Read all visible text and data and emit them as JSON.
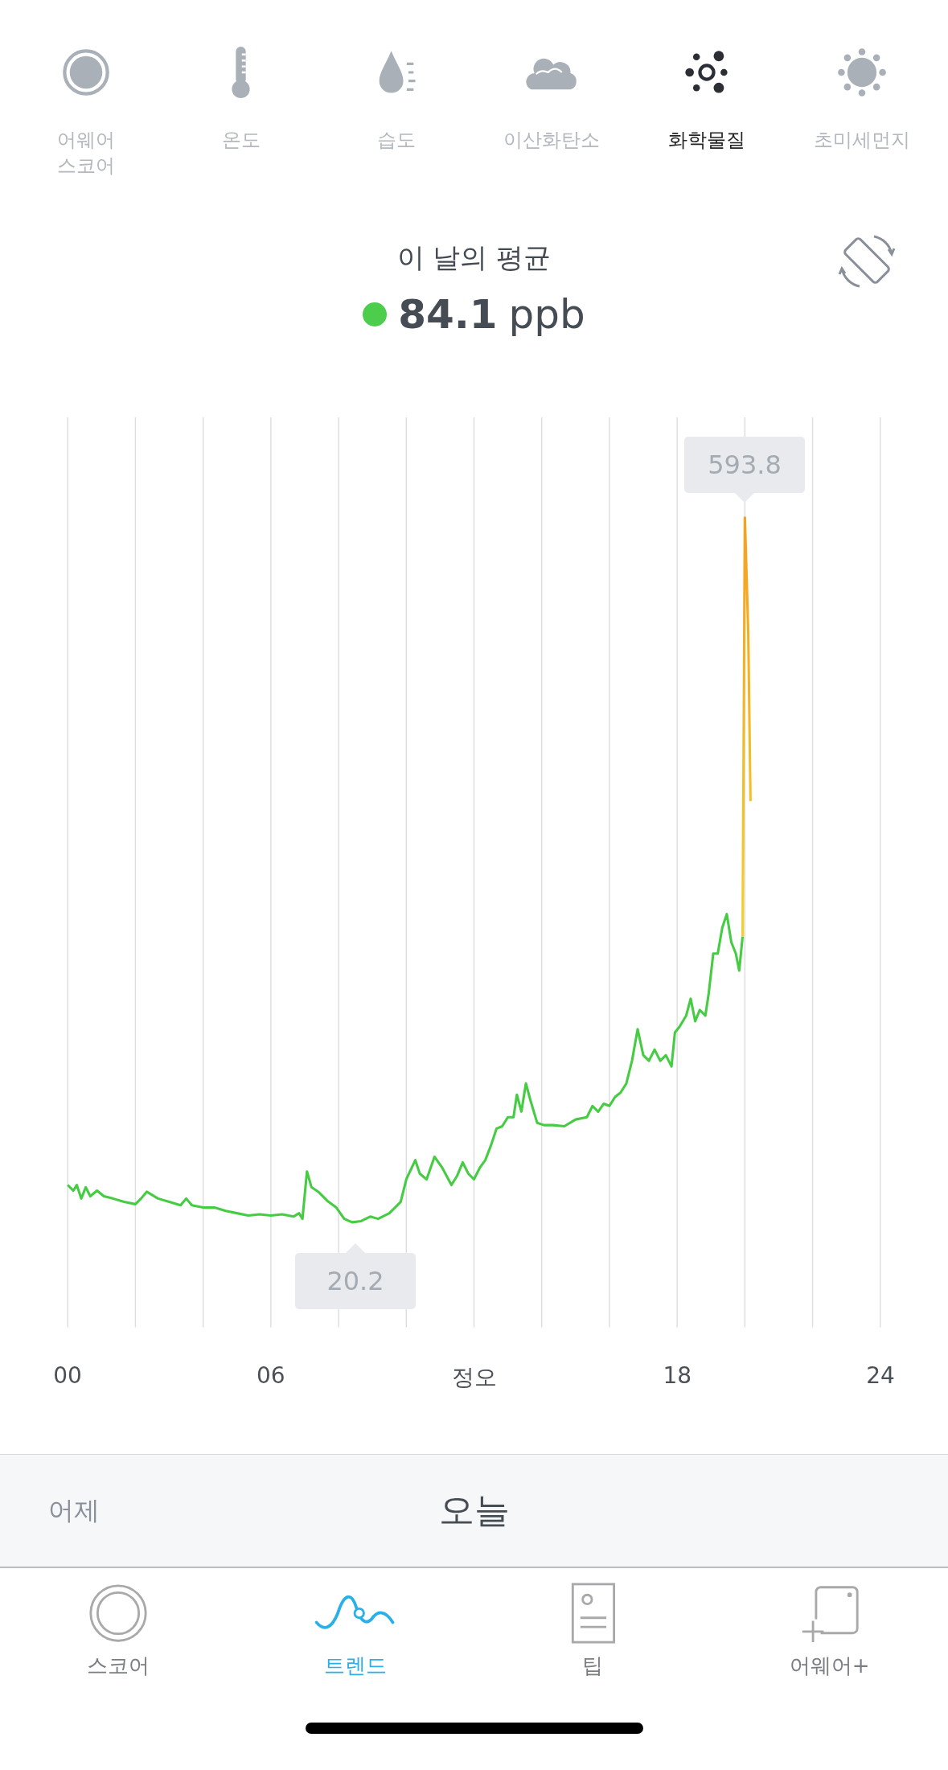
{
  "metric_tabs": [
    {
      "label": "어웨어\n스코어",
      "selected": false
    },
    {
      "label": "온도",
      "selected": false
    },
    {
      "label": "습도",
      "selected": false
    },
    {
      "label": "이산화탄소",
      "selected": false
    },
    {
      "label": "화학물질",
      "selected": true
    },
    {
      "label": "초미세먼지",
      "selected": false
    }
  ],
  "average": {
    "title": "이 날의 평균",
    "value": "84.1",
    "unit": "ppb"
  },
  "chart": {
    "max_label": "593.8",
    "min_label": "20.2",
    "x_labels": [
      "00",
      "06",
      "정오",
      "18",
      "24"
    ]
  },
  "days": [
    {
      "label": "어제",
      "selected": false
    },
    {
      "label": "오늘",
      "selected": true
    }
  ],
  "nav": [
    {
      "label": "스코어",
      "selected": false
    },
    {
      "label": "트렌드",
      "selected": true
    },
    {
      "label": "팁",
      "selected": false
    },
    {
      "label": "어웨어+",
      "selected": false
    }
  ]
}
